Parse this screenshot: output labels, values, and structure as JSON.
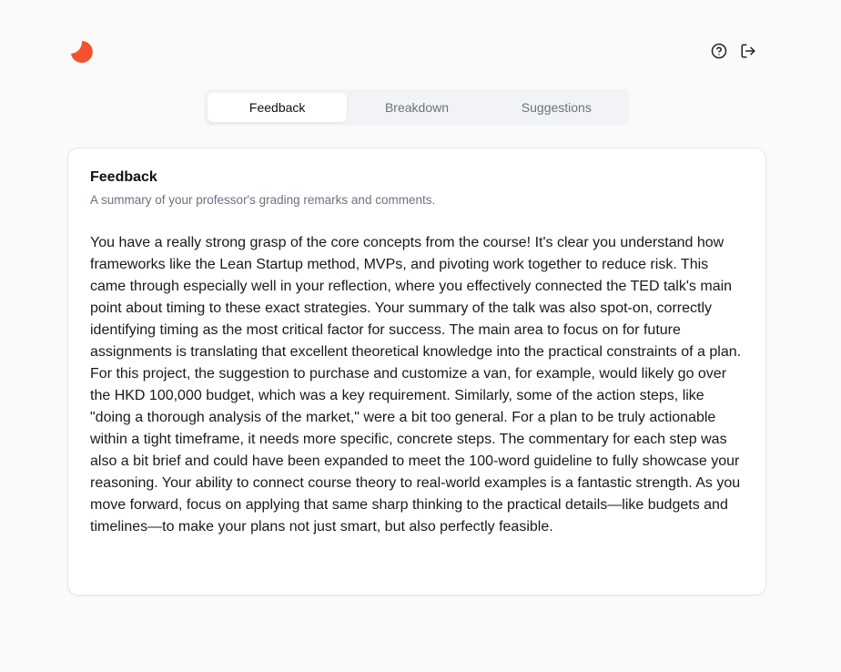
{
  "brand": {
    "accent": "#f4522c",
    "logo_icon": "crescent-logo-icon"
  },
  "header": {
    "help_icon": "help-circle-icon",
    "logout_icon": "logout-icon"
  },
  "tabs": [
    {
      "label": "Feedback",
      "active": true
    },
    {
      "label": "Breakdown",
      "active": false
    },
    {
      "label": "Suggestions",
      "active": false
    }
  ],
  "card": {
    "title": "Feedback",
    "subtitle": "A summary of your professor's grading remarks and comments.",
    "body": "You have a really strong grasp of the core concepts from the course! It's clear you understand how frameworks like the Lean Startup method, MVPs, and pivoting work together to reduce risk. This came through especially well in your reflection, where you effectively connected the TED talk's main point about timing to these exact strategies. Your summary of the talk was also spot-on, correctly identifying timing as the most critical factor for success. The main area to focus on for future assignments is translating that excellent theoretical knowledge into the practical constraints of a plan. For this project, the suggestion to purchase and customize a van, for example, would likely go over the HKD 100,000 budget, which was a key requirement. Similarly, some of the action steps, like \"doing a thorough analysis of the market,\" were a bit too general. For a plan to be truly actionable within a tight timeframe, it needs more specific, concrete steps. The commentary for each step was also a bit brief and could have been expanded to meet the 100-word guideline to fully showcase your reasoning. Your ability to connect course theory to real-world examples is a fantastic strength. As you move forward, focus on applying that same sharp thinking to the practical details—like budgets and timelines—to make your plans not just smart, but also perfectly feasible."
  }
}
